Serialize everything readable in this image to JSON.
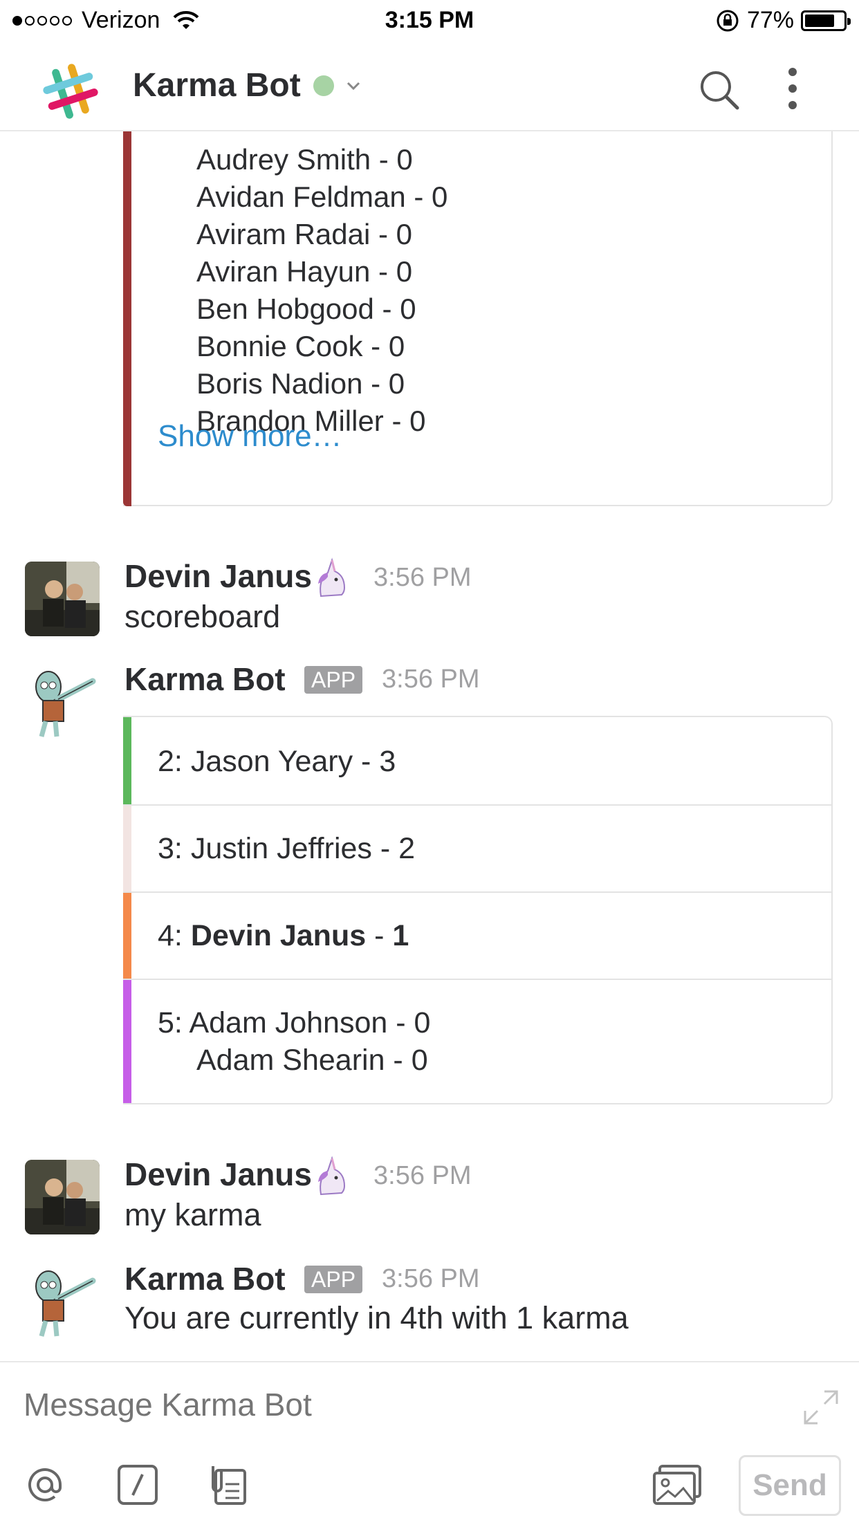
{
  "status_bar": {
    "carrier": "Verizon",
    "time": "3:15 PM",
    "battery": "77%",
    "battery_level": 0.77
  },
  "header": {
    "title": "Karma Bot",
    "presence": "online",
    "icons": [
      "slack-logo-icon",
      "chevron-down-icon",
      "search-icon",
      "more-vertical-icon"
    ]
  },
  "previous_attachment": {
    "names": [
      "Audrey Smith - 0",
      "Avidan Feldman - 0",
      "Aviram Radai - 0",
      "Aviran Hayun - 0",
      "Ben Hobgood - 0",
      "Bonnie Cook - 0",
      "Boris Nadion - 0",
      "Brandon Miller - 0"
    ],
    "show_more": "Show more…",
    "color": "#9b3636"
  },
  "messages": [
    {
      "author": "Devin Janus",
      "emoji": "unicorn-icon",
      "time": "3:56 PM",
      "text": "scoreboard"
    },
    {
      "author": "Karma Bot",
      "badge": "APP",
      "time": "3:56 PM",
      "scoreboard": [
        {
          "rank": "2: ",
          "name": "Jason Yeary",
          "score": " - 3",
          "color": "#5cb85c"
        },
        {
          "rank": "3: ",
          "name": "Justin Jeffries",
          "score": " - 2",
          "color": "#f2e4e2"
        },
        {
          "rank": "4: ",
          "name": "Devin Janus",
          "score": " - ",
          "score_value": "1",
          "color": "#f4894a"
        },
        {
          "rank": "5: ",
          "name": "Adam Johnson",
          "score": " - 0",
          "extra": "Adam Shearin - 0",
          "color": "#c65ee8"
        }
      ]
    },
    {
      "author": "Devin Janus",
      "emoji": "unicorn-icon",
      "time": "3:56 PM",
      "text": "my karma"
    },
    {
      "author": "Karma Bot",
      "badge": "APP",
      "time": "3:56 PM",
      "text": "You are currently in 4th with 1 karma"
    }
  ],
  "composer": {
    "placeholder": "Message Karma Bot",
    "send_label": "Send",
    "icons": [
      "at-icon",
      "slash-command-icon",
      "files-icon",
      "photo-icon",
      "expand-icon"
    ]
  }
}
